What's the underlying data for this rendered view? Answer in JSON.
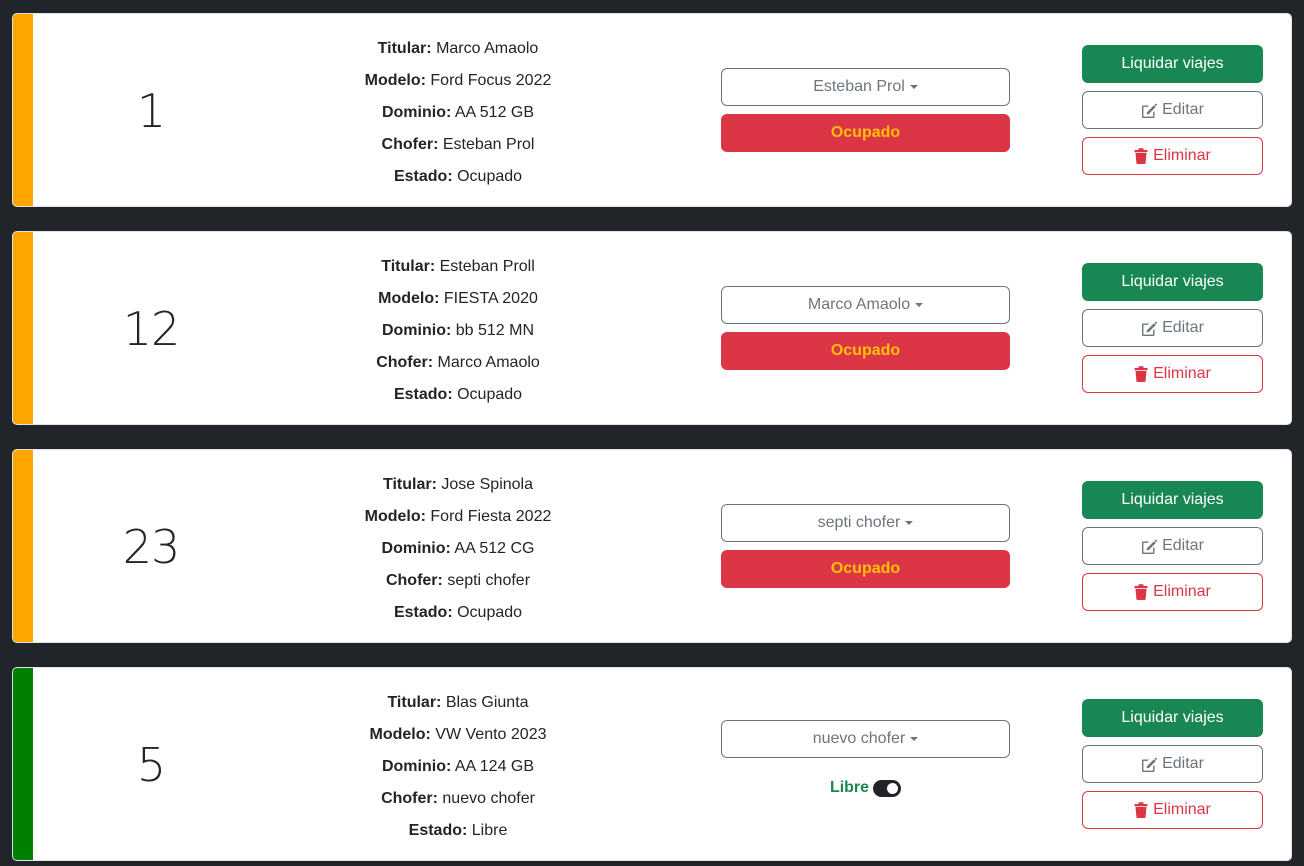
{
  "colors": {
    "ocupado_stripe": "#ffa500",
    "libre_stripe": "#008000",
    "success": "#198754",
    "danger": "#dc3545",
    "warning": "#ffc107",
    "secondary": "#6c757d",
    "background": "#212529"
  },
  "labels": {
    "titular": "Titular:",
    "modelo": "Modelo:",
    "dominio": "Dominio:",
    "chofer": "Chofer:",
    "estado": "Estado:",
    "liquidar": "Liquidar viajes",
    "editar": "Editar",
    "eliminar": "Eliminar"
  },
  "icons": {
    "edit": "edit-icon",
    "delete": "trash-icon"
  },
  "cars": [
    {
      "number": "1",
      "titular": "Marco Amaolo",
      "modelo": "Ford Focus 2022",
      "dominio": "AA 512 GB",
      "chofer": "Esteban Prol",
      "estado": "Ocupado",
      "dropdown": "Esteban Prol",
      "status_button": "Ocupado"
    },
    {
      "number": "12",
      "titular": "Esteban Proll",
      "modelo": "FIESTA 2020",
      "dominio": "bb 512 MN",
      "chofer": "Marco Amaolo",
      "estado": "Ocupado",
      "dropdown": "Marco Amaolo",
      "status_button": "Ocupado"
    },
    {
      "number": "23",
      "titular": "Jose Spinola",
      "modelo": "Ford Fiesta 2022",
      "dominio": "AA 512 CG",
      "chofer": "septi chofer",
      "estado": "Ocupado",
      "dropdown": "septi chofer",
      "status_button": "Ocupado"
    },
    {
      "number": "5",
      "titular": "Blas Giunta",
      "modelo": "VW Vento 2023",
      "dominio": "AA 124 GB",
      "chofer": "nuevo chofer",
      "estado": "Libre",
      "dropdown": "nuevo chofer",
      "status_toggle_label": "Libre",
      "toggle_on": true
    }
  ]
}
